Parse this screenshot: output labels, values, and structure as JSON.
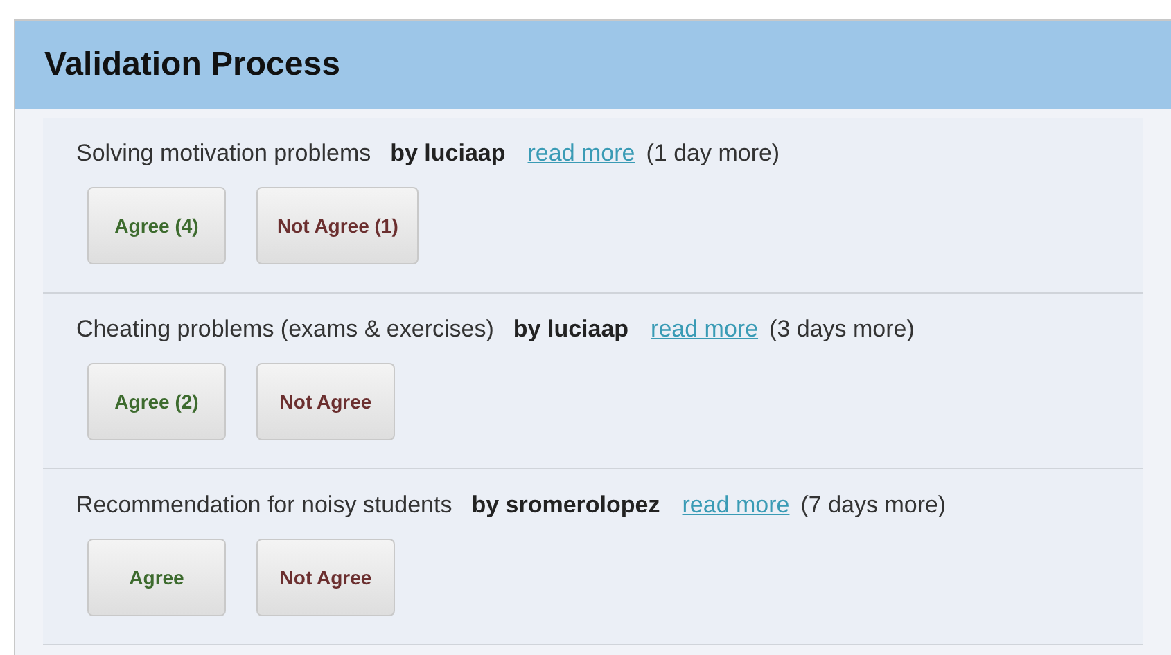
{
  "panel": {
    "title": "Validation Process"
  },
  "proposals": [
    {
      "title": "Solving motivation problems",
      "author": "by luciaap",
      "link": "read more",
      "remaining": "(1 day more)",
      "buttons": [
        {
          "kind": "agree",
          "label": "Agree (4)"
        },
        {
          "kind": "disagree",
          "label": "Not Agree (1)"
        }
      ]
    },
    {
      "title": "Cheating problems  (exams & exercises)",
      "author": "by luciaap",
      "link": "read more",
      "remaining": "(3 days more)",
      "buttons": [
        {
          "kind": "agree",
          "label": "Agree (2)"
        },
        {
          "kind": "disagree",
          "label": "Not Agree"
        }
      ]
    },
    {
      "title": "Recommendation for noisy students",
      "author": "by sromerolopez",
      "link": "read more",
      "remaining": "(7 days more)",
      "buttons": [
        {
          "kind": "agree",
          "label": "Agree"
        },
        {
          "kind": "disagree",
          "label": "Not Agree"
        }
      ]
    }
  ]
}
